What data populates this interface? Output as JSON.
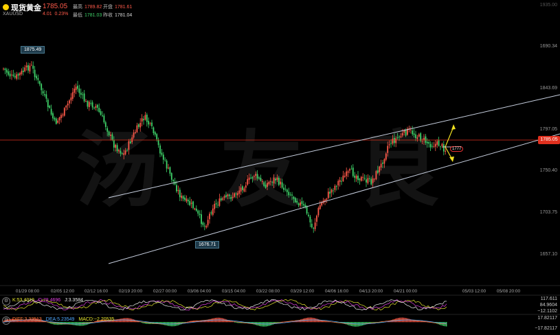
{
  "header": {
    "name": "现货黄金",
    "code": "XAUUSD",
    "price": "1785.05",
    "change": "4.01",
    "change_pct": "0.23%",
    "high_label": "最高",
    "high": "1789.82",
    "open_label": "开盘",
    "open": "1781.61",
    "low_label": "最低",
    "low": "1781.03",
    "prev_label": "昨收",
    "prev": "1781.04"
  },
  "price_axis": [
    "1690.34",
    "1843.69",
    "1797.05",
    "1750.40",
    "1703.75",
    "1657.10"
  ],
  "price_axis_top": "1935.00",
  "current_price": "1785.05",
  "callouts": {
    "high": "1875.49",
    "low": "1676.71"
  },
  "drawing_label": "1777",
  "watermark": [
    "汤",
    "友",
    "良"
  ],
  "dates": [
    "01/29 08:00",
    "02/05 12:00",
    "02/12 16:00",
    "02/19 20:00",
    "02/27 00:00",
    "03/06 04:00",
    "03/15 04:00",
    "03/22 08:00",
    "03/29 12:00",
    "04/06 16:00",
    "04/13 20:00",
    "04/21 00:00",
    "05/03 12:00",
    "05/08 20:00"
  ],
  "kdj": {
    "k": "K:53.4319",
    "d": "D:78.4696",
    "j": "J:3.3584"
  },
  "kdj_axis": [
    "117.611",
    "84.9604",
    "−12.1102"
  ],
  "macd": {
    "diff": "DIFF:3.33513",
    "dea": "DEA:5.23549",
    "macd": "MACD:−2.20535"
  },
  "macd_axis": [
    "17.82117",
    "−17.82117"
  ],
  "colors": {
    "up": "#ff5a4a",
    "down": "#3fd46a",
    "channel": "#c8d0e0",
    "price_line": "#e0301e"
  }
}
